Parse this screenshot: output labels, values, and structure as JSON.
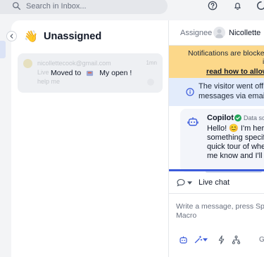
{
  "search": {
    "placeholder": "Search in Inbox..."
  },
  "topbar": {
    "icons": [
      "help-icon",
      "bell-icon",
      "spinner-icon"
    ]
  },
  "inbox": {
    "title": "Unassigned",
    "title_emoji": "👋",
    "conversation": {
      "email": "nicollettecook@gmail.com",
      "time": "1mn",
      "preview_line1": "Live",
      "preview_line2": "help me"
    },
    "tooltip": {
      "prefix": "Moved to",
      "destination": "My open !"
    }
  },
  "conversation_panel": {
    "assignee_label": "Assignee",
    "assignee_name": "Nicollette",
    "notification": {
      "text": "Notifications are blocke",
      "text_continued": "inc",
      "link": "read how to allow"
    },
    "offline": {
      "line1": "The visitor went offlin",
      "line2": "messages via email."
    },
    "copilot": {
      "name": "Copilot",
      "source": "Data so",
      "message_lines": [
        "Hello! 😊 I'm here",
        "something specifi",
        "quick tour of wher",
        "me know and I'll g"
      ]
    },
    "channel": {
      "label": "Live chat"
    },
    "composer": {
      "placeholder_line1": "Write a message, press Spac",
      "placeholder_line2": "Macro"
    },
    "tools": {
      "last_label": "G"
    }
  },
  "colors": {
    "accent": "#3b5bdb",
    "notification_bg": "#fcd88a",
    "info_bg": "#e3ecfb",
    "success": "#22a55a"
  }
}
